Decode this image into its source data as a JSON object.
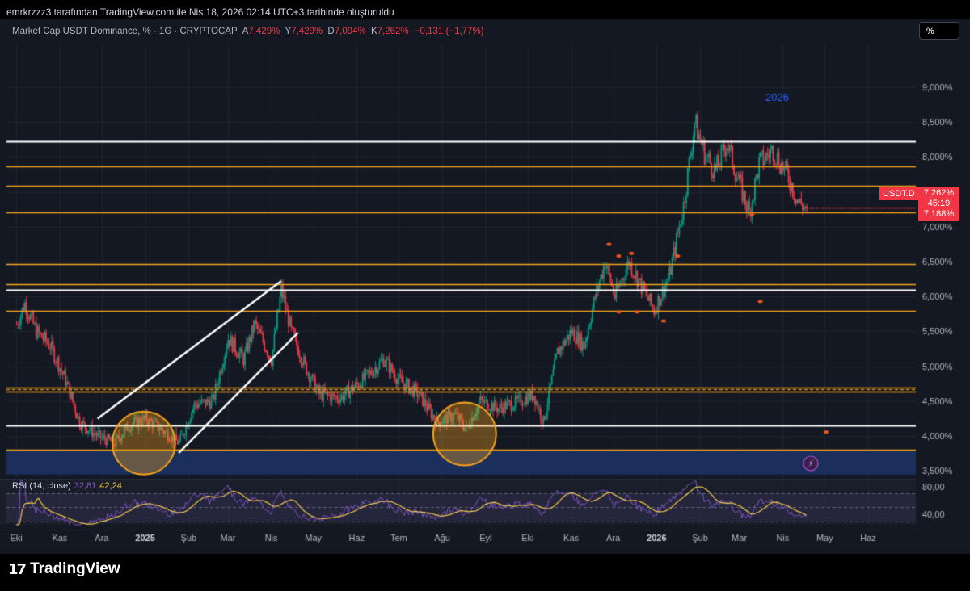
{
  "attribution": "emrkrzzz3 tarafından TradingView.com ile Nis 18, 2026 02:14 UTC+3 tarihinde oluşturuldu",
  "legend": {
    "symbol": "Market Cap USDT Dominance, % · 1G · CRYPTOCAP",
    "open_label": "A",
    "open": "7,429%",
    "high_label": "Y",
    "high": "7,429%",
    "low_label": "D",
    "low": "7,094%",
    "close_label": "K",
    "close": "7,262%",
    "change": "−0,131 (−1,77%)"
  },
  "scale_button": "%",
  "rsi_legend": {
    "label": "RSI (14, close)",
    "rsi": "32,81",
    "ma": "42,24"
  },
  "price_tag": {
    "symbol": "USDT.D",
    "price": "7,262%",
    "countdown": "45:19",
    "low": "7,188%"
  },
  "brand": {
    "mark": "17",
    "name": "TradingView"
  },
  "colors": {
    "background": "#141823",
    "up": "#089981",
    "down": "#f23645",
    "orange": "#f7a21b",
    "white_line": "#ffffff",
    "rsi_line": "#7e57c2",
    "rsi_ma": "#f2c94c",
    "zone": "#1e3670"
  },
  "chart_data": {
    "type": "candlestick",
    "x_axis_labels": [
      "Eki",
      "Kas",
      "Ara",
      "2025",
      "Şub",
      "Mar",
      "Nis",
      "May",
      "Haz",
      "Tem",
      "Ağu",
      "Eyl",
      "Eki",
      "Kas",
      "Ara",
      "2026",
      "Şub",
      "Mar",
      "Nis",
      "May",
      "Haz"
    ],
    "x_axis_dates": [
      "2024-10-01",
      "2024-11-01",
      "2024-12-01",
      "2025-01-01",
      "2025-02-01",
      "2025-03-01",
      "2025-04-01",
      "2025-05-01",
      "2025-06-01",
      "2025-07-01",
      "2025-08-01",
      "2025-09-01",
      "2025-10-01",
      "2025-11-01",
      "2025-12-01",
      "2026-01-01",
      "2026-02-01",
      "2026-03-01",
      "2026-04-01",
      "2026-05-01",
      "2026-06-01"
    ],
    "y_axis_labels": [
      "9,000%",
      "8,500%",
      "8,000%",
      "7,500%",
      "7,000%",
      "6,500%",
      "6,000%",
      "5,500%",
      "5,000%",
      "4,500%",
      "4,000%",
      "3,500%"
    ],
    "y_range": [
      3.4,
      9.6
    ],
    "price_path": [
      [
        "2024-10-01",
        5.6
      ],
      [
        "2024-10-07",
        5.9
      ],
      [
        "2024-10-15",
        5.5
      ],
      [
        "2024-10-25",
        5.3
      ],
      [
        "2024-11-05",
        4.8
      ],
      [
        "2024-11-15",
        4.2
      ],
      [
        "2024-11-28",
        4.0
      ],
      [
        "2024-12-10",
        3.9
      ],
      [
        "2024-12-20",
        4.15
      ],
      [
        "2025-01-01",
        4.25
      ],
      [
        "2025-01-12",
        4.1
      ],
      [
        "2025-01-25",
        3.9
      ],
      [
        "2025-02-05",
        4.45
      ],
      [
        "2025-02-18",
        4.5
      ],
      [
        "2025-03-01",
        5.4
      ],
      [
        "2025-03-12",
        5.1
      ],
      [
        "2025-03-20",
        5.6
      ],
      [
        "2025-04-01",
        5.1
      ],
      [
        "2025-04-08",
        6.1
      ],
      [
        "2025-04-15",
        5.5
      ],
      [
        "2025-04-25",
        5.0
      ],
      [
        "2025-05-05",
        4.6
      ],
      [
        "2025-05-20",
        4.55
      ],
      [
        "2025-06-05",
        4.8
      ],
      [
        "2025-06-20",
        5.1
      ],
      [
        "2025-07-01",
        4.8
      ],
      [
        "2025-07-15",
        4.6
      ],
      [
        "2025-07-28",
        4.2
      ],
      [
        "2025-08-10",
        4.3
      ],
      [
        "2025-08-18",
        4.1
      ],
      [
        "2025-08-28",
        4.5
      ],
      [
        "2025-09-10",
        4.4
      ],
      [
        "2025-09-25",
        4.5
      ],
      [
        "2025-10-05",
        4.6
      ],
      [
        "2025-10-12",
        4.2
      ],
      [
        "2025-10-22",
        5.2
      ],
      [
        "2025-11-01",
        5.5
      ],
      [
        "2025-11-10",
        5.3
      ],
      [
        "2025-11-18",
        6.0
      ],
      [
        "2025-11-25",
        6.5
      ],
      [
        "2025-12-02",
        6.0
      ],
      [
        "2025-12-12",
        6.5
      ],
      [
        "2025-12-22",
        6.1
      ],
      [
        "2025-12-30",
        5.8
      ],
      [
        "2026-01-10",
        6.3
      ],
      [
        "2026-01-20",
        7.3
      ],
      [
        "2026-01-28",
        8.5
      ],
      [
        "2026-02-05",
        8.0
      ],
      [
        "2026-02-12",
        7.8
      ],
      [
        "2026-02-20",
        8.2
      ],
      [
        "2026-03-01",
        7.6
      ],
      [
        "2026-03-08",
        7.2
      ],
      [
        "2026-03-15",
        7.9
      ],
      [
        "2026-03-25",
        8.1
      ],
      [
        "2026-04-05",
        7.7
      ],
      [
        "2026-04-12",
        7.35
      ],
      [
        "2026-04-18",
        7.26
      ]
    ],
    "horizontal_levels": [
      {
        "price": 8.22,
        "color": "white"
      },
      {
        "price": 7.87,
        "color": "orange"
      },
      {
        "price": 7.59,
        "color": "orange"
      },
      {
        "price": 7.2,
        "color": "orange"
      },
      {
        "price": 6.47,
        "color": "orange"
      },
      {
        "price": 6.18,
        "color": "orange"
      },
      {
        "price": 6.1,
        "color": "white"
      },
      {
        "price": 5.8,
        "color": "orange"
      },
      {
        "price": 4.69,
        "color": "orange"
      },
      {
        "price": 4.64,
        "color": "orange"
      },
      {
        "price": 4.15,
        "color": "white"
      },
      {
        "price": 3.8,
        "color": "orange"
      }
    ],
    "zone": {
      "from": 3.45,
      "to": 3.8
    },
    "annotation": "2026",
    "rsi_axis_labels": [
      "80,00",
      "40,00"
    ],
    "rsi_range": [
      25,
      90
    ],
    "rsi_levels": [
      70,
      50,
      30
    ]
  }
}
